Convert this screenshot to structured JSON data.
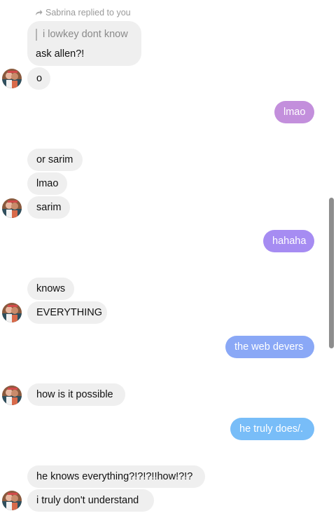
{
  "reply_header": "Sabrina replied to you",
  "quoted_text": "i lowkey dont know",
  "messages": {
    "m1": "ask allen?!",
    "m2": "o",
    "m3": "lmao",
    "m4": "or sarim",
    "m5": "lmao",
    "m6": "sarim",
    "m7": "hahaha",
    "m8": "knows",
    "m9": "EVERYTHING",
    "m10": "the web devers",
    "m11": "how is it possible",
    "m12": "he truly does/.",
    "m13": "he knows everything?!?!?!!how!?!?",
    "m14": "i truly don't understand"
  },
  "colors": {
    "incoming_bubble": "#efefef",
    "outgoing_purple": "#c38fdc",
    "outgoing_violet": "#a68cf2",
    "outgoing_blue": "#8aa8f6",
    "outgoing_sky": "#78bdf8"
  }
}
